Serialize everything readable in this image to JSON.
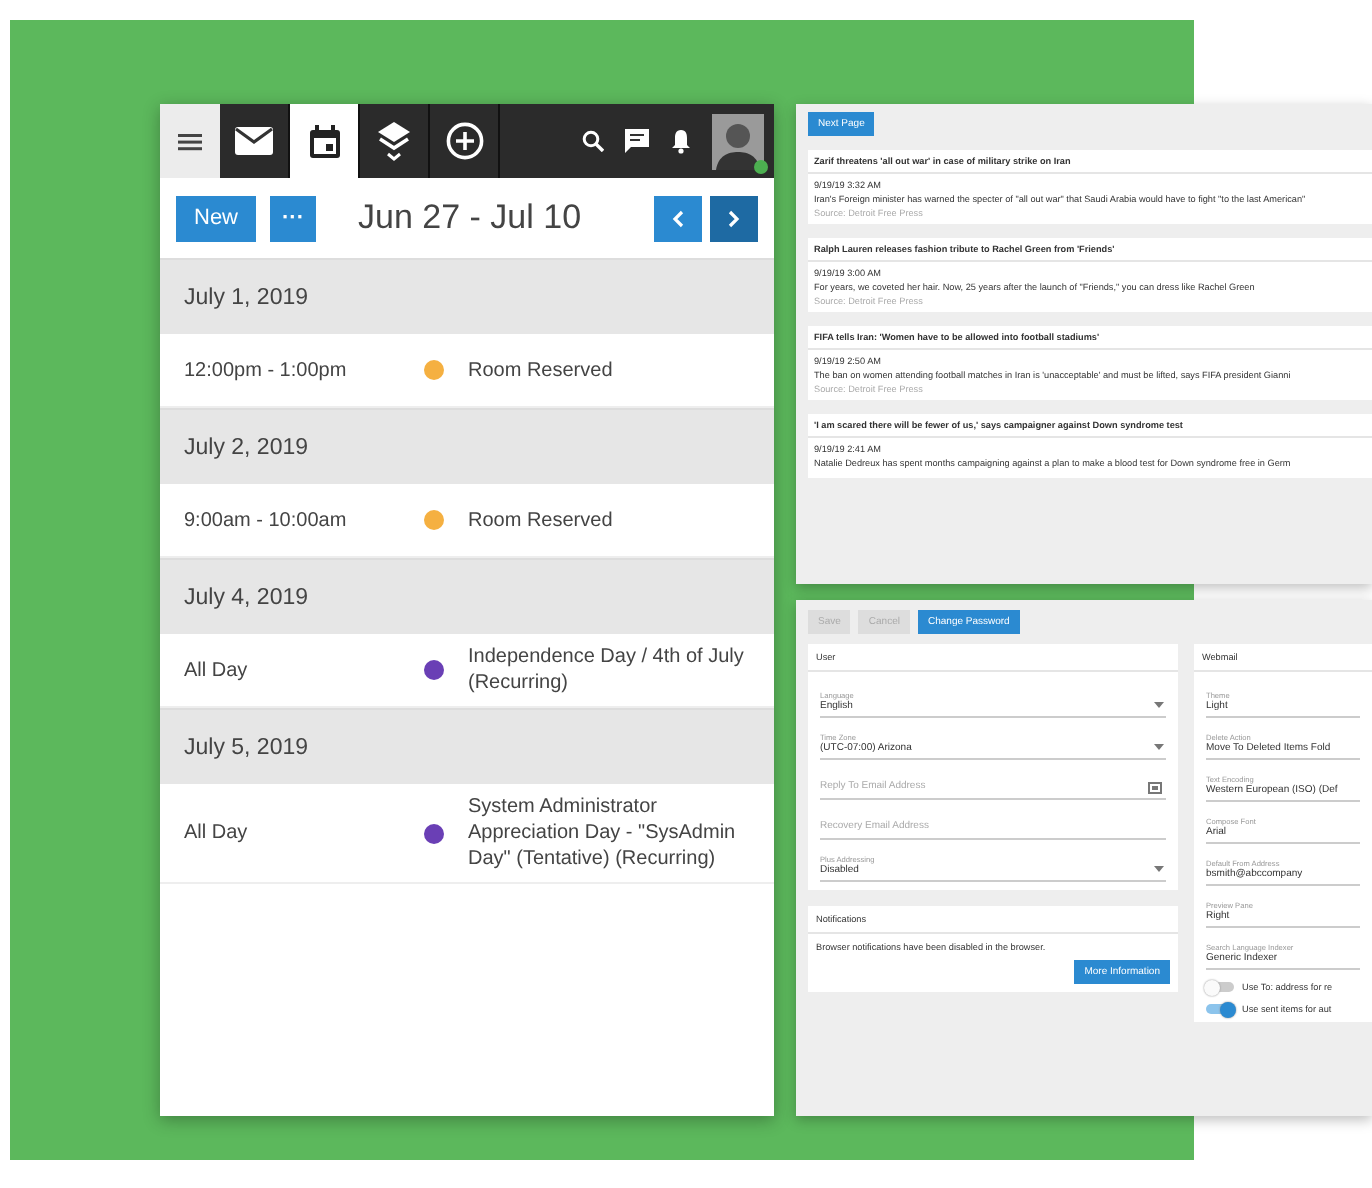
{
  "calendar": {
    "tabs": [
      {
        "kind": "mail",
        "selected": false
      },
      {
        "kind": "calendar",
        "selected": true
      },
      {
        "kind": "layers",
        "selected": false
      },
      {
        "kind": "add",
        "selected": false
      }
    ],
    "toolbar": {
      "new_button": "New",
      "more_button": "···",
      "range": "Jun 27 - Jul 10"
    },
    "days": [
      {
        "date": "July 1, 2019",
        "events": [
          {
            "time": "12:00pm - 1:00pm",
            "title": "Room Reserved",
            "color": "#f5b041"
          }
        ]
      },
      {
        "date": "July 2, 2019",
        "events": [
          {
            "time": "9:00am - 10:00am",
            "title": "Room Reserved",
            "color": "#f5b041"
          }
        ]
      },
      {
        "date": "July 4, 2019",
        "events": [
          {
            "time": "All Day",
            "title": "Independence Day / 4th of July (Recurring)",
            "color": "#6a3fb5"
          }
        ]
      },
      {
        "date": "July 5, 2019",
        "events": [
          {
            "time": "All Day",
            "title": "System Administrator Appreciation Day - \"SysAdmin Day\" (Tentative) (Recurring)",
            "color": "#6a3fb5"
          }
        ]
      }
    ]
  },
  "news": {
    "next_button": "Next Page",
    "items": [
      {
        "headline": "Zarif threatens 'all out war' in case of military strike on Iran",
        "time": "9/19/19 3:32 AM",
        "summary": "Iran's Foreign minister has warned the specter of \"all out war\" that Saudi Arabia would have to fight \"to the last American\"",
        "source": "Source: Detroit Free Press"
      },
      {
        "headline": "Ralph Lauren releases fashion tribute to Rachel Green from 'Friends'",
        "time": "9/19/19 3:00 AM",
        "summary": "For years, we coveted her hair. Now, 25 years after the launch of \"Friends,\" you can dress like Rachel Green",
        "source": "Source: Detroit Free Press"
      },
      {
        "headline": "FIFA tells Iran: 'Women have to be allowed into football stadiums'",
        "time": "9/19/19 2:50 AM",
        "summary": "The ban on women attending football matches in Iran is 'unacceptable' and must be lifted, says FIFA president Gianni",
        "source": "Source: Detroit Free Press"
      },
      {
        "headline": "'I am scared there will be fewer of us,' says campaigner against Down syndrome test",
        "time": "9/19/19 2:41 AM",
        "summary": "Natalie Dedreux has spent months campaigning against a plan to make a blood test for Down syndrome free in Germ"
      }
    ]
  },
  "settings": {
    "buttons": [
      {
        "label": "Save",
        "disabled": true
      },
      {
        "label": "Cancel",
        "disabled": true
      },
      {
        "label": "Change Password",
        "disabled": false
      }
    ],
    "user": {
      "title": "User",
      "fields": [
        {
          "kind": "select",
          "label": "Language",
          "value": "English"
        },
        {
          "kind": "select",
          "label": "Time Zone",
          "value": "(UTC-07:00) Arizona"
        },
        {
          "kind": "input",
          "placeholder": "Reply To Email Address",
          "icon": true
        },
        {
          "kind": "input",
          "placeholder": "Recovery Email Address"
        },
        {
          "kind": "select",
          "label": "Plus Addressing",
          "value": "Disabled"
        }
      ]
    },
    "notifications": {
      "title": "Notifications",
      "text": "Browser notifications have been disabled in the browser.",
      "button": "More Information"
    },
    "webmail": {
      "title": "Webmail",
      "fields": [
        {
          "label": "Theme",
          "value": "Light"
        },
        {
          "label": "Delete Action",
          "value": "Move To Deleted Items Fold"
        },
        {
          "label": "Text Encoding",
          "value": "Western European (ISO) (Def"
        },
        {
          "label": "Compose Font",
          "value": "Arial"
        },
        {
          "label": "Default From Address",
          "value": "bsmith@abccompany"
        },
        {
          "label": "Preview Pane",
          "value": "Right"
        },
        {
          "label": "Search Language Indexer",
          "value": "Generic Indexer"
        }
      ],
      "toggles": [
        {
          "label": "Use To: address for re",
          "on": false
        },
        {
          "label": "Use sent items for aut",
          "on": true
        }
      ]
    }
  }
}
